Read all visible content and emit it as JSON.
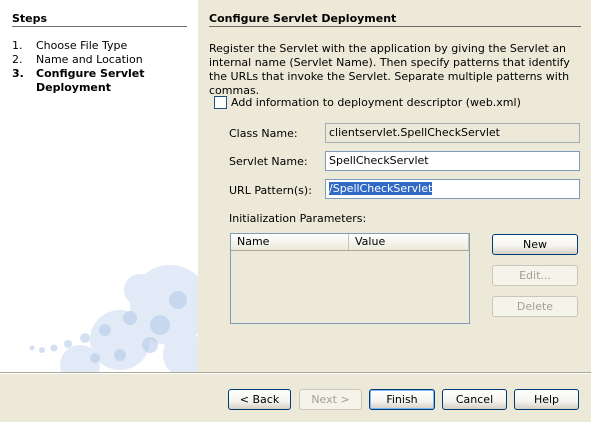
{
  "steps": {
    "title": "Steps",
    "items": [
      {
        "num": "1.",
        "label": "Choose File Type",
        "current": false
      },
      {
        "num": "2.",
        "label": "Name and Location",
        "current": false
      },
      {
        "num": "3.",
        "label": "Configure Servlet Deployment",
        "current": true
      }
    ]
  },
  "page": {
    "title": "Configure Servlet Deployment",
    "description": "Register the Servlet with the application by giving the Servlet an internal name (Servlet Name). Then specify patterns that identify the URLs that invoke the Servlet. Separate multiple patterns with commas."
  },
  "deployment_descriptor": {
    "label": "Add information to deployment descriptor (web.xml)",
    "checked": false
  },
  "fields": {
    "class_name": {
      "label": "Class Name:",
      "value": "clientservlet.SpellCheckServlet"
    },
    "servlet_name": {
      "label": "Servlet Name:",
      "value": "SpellCheckServlet"
    },
    "url_pattern": {
      "label": "URL Pattern(s):",
      "value": "/SpellCheckServlet"
    }
  },
  "init_params": {
    "label": "Initialization Parameters:",
    "columns": [
      "Name",
      "Value"
    ],
    "rows": [],
    "buttons": {
      "new": "New",
      "edit": "Edit...",
      "delete": "Delete"
    }
  },
  "footer": {
    "back": "< Back",
    "next": "Next >",
    "finish": "Finish",
    "cancel": "Cancel",
    "help": "Help"
  },
  "colors": {
    "selection": "#316ac5",
    "dialog_bg": "#ece9d8",
    "bubble": "#c8d8ef"
  }
}
